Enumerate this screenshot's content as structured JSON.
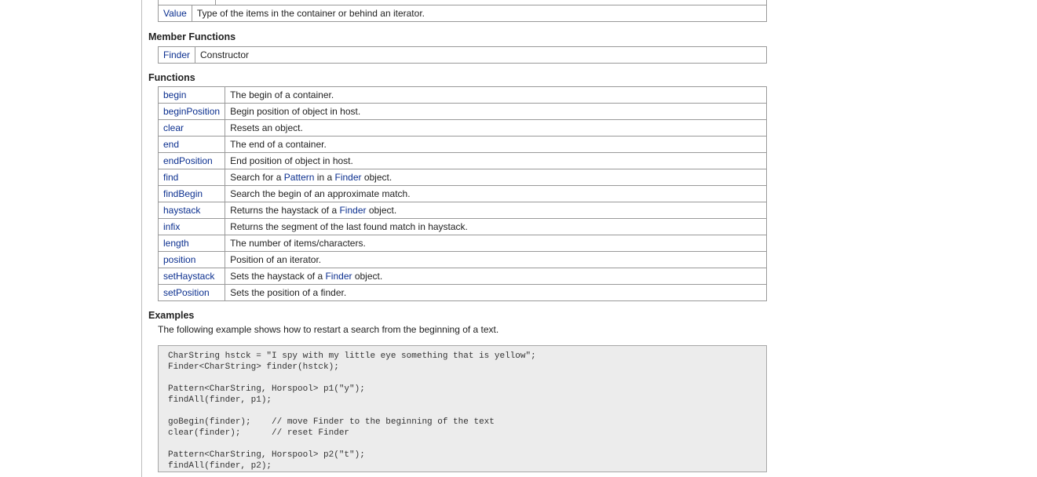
{
  "types_table": {
    "rows": [
      {
        "name": "Value",
        "desc": "Type of the items in the container or behind an iterator."
      }
    ]
  },
  "member_functions": {
    "title": "Member Functions",
    "rows": [
      {
        "name": "Finder",
        "desc": "Constructor"
      }
    ]
  },
  "functions": {
    "title": "Functions",
    "rows": [
      {
        "name": "begin",
        "desc": "The begin of a container."
      },
      {
        "name": "beginPosition",
        "desc": "Begin position of object in host."
      },
      {
        "name": "clear",
        "desc": "Resets an object."
      },
      {
        "name": "end",
        "desc": "The end of a container."
      },
      {
        "name": "endPosition",
        "desc": "End position of object in host."
      },
      {
        "name": "find",
        "desc_parts": [
          "Search for a ",
          "Pattern",
          " in a ",
          "Finder",
          " object."
        ]
      },
      {
        "name": "findBegin",
        "desc": "Search the begin of an approximate match."
      },
      {
        "name": "haystack",
        "desc_parts": [
          "Returns the haystack of a ",
          "Finder",
          " object."
        ]
      },
      {
        "name": "infix",
        "desc": "Returns the segment of the last found match in haystack."
      },
      {
        "name": "length",
        "desc": "The number of items/characters."
      },
      {
        "name": "position",
        "desc": "Position of an iterator."
      },
      {
        "name": "setHaystack",
        "desc_parts": [
          "Sets the haystack of a ",
          "Finder",
          " object."
        ]
      },
      {
        "name": "setPosition",
        "desc": "Sets the position of a finder."
      }
    ]
  },
  "examples": {
    "title": "Examples",
    "intro": "The following example shows how to restart a search from the beginning of a text.",
    "code_lines": [
      "CharString hstck = \"I spy with my little eye something that is yellow\";",
      "Finder<CharString> finder(hstck);",
      "",
      "Pattern<CharString, Horspool> p1(\"y\");",
      "findAll(finder, p1);",
      "",
      "goBegin(finder);    // move Finder to the beginning of the text",
      "clear(finder);      // reset Finder",
      "",
      "Pattern<CharString, Horspool> p2(\"t\");",
      "findAll(finder, p2);"
    ]
  }
}
